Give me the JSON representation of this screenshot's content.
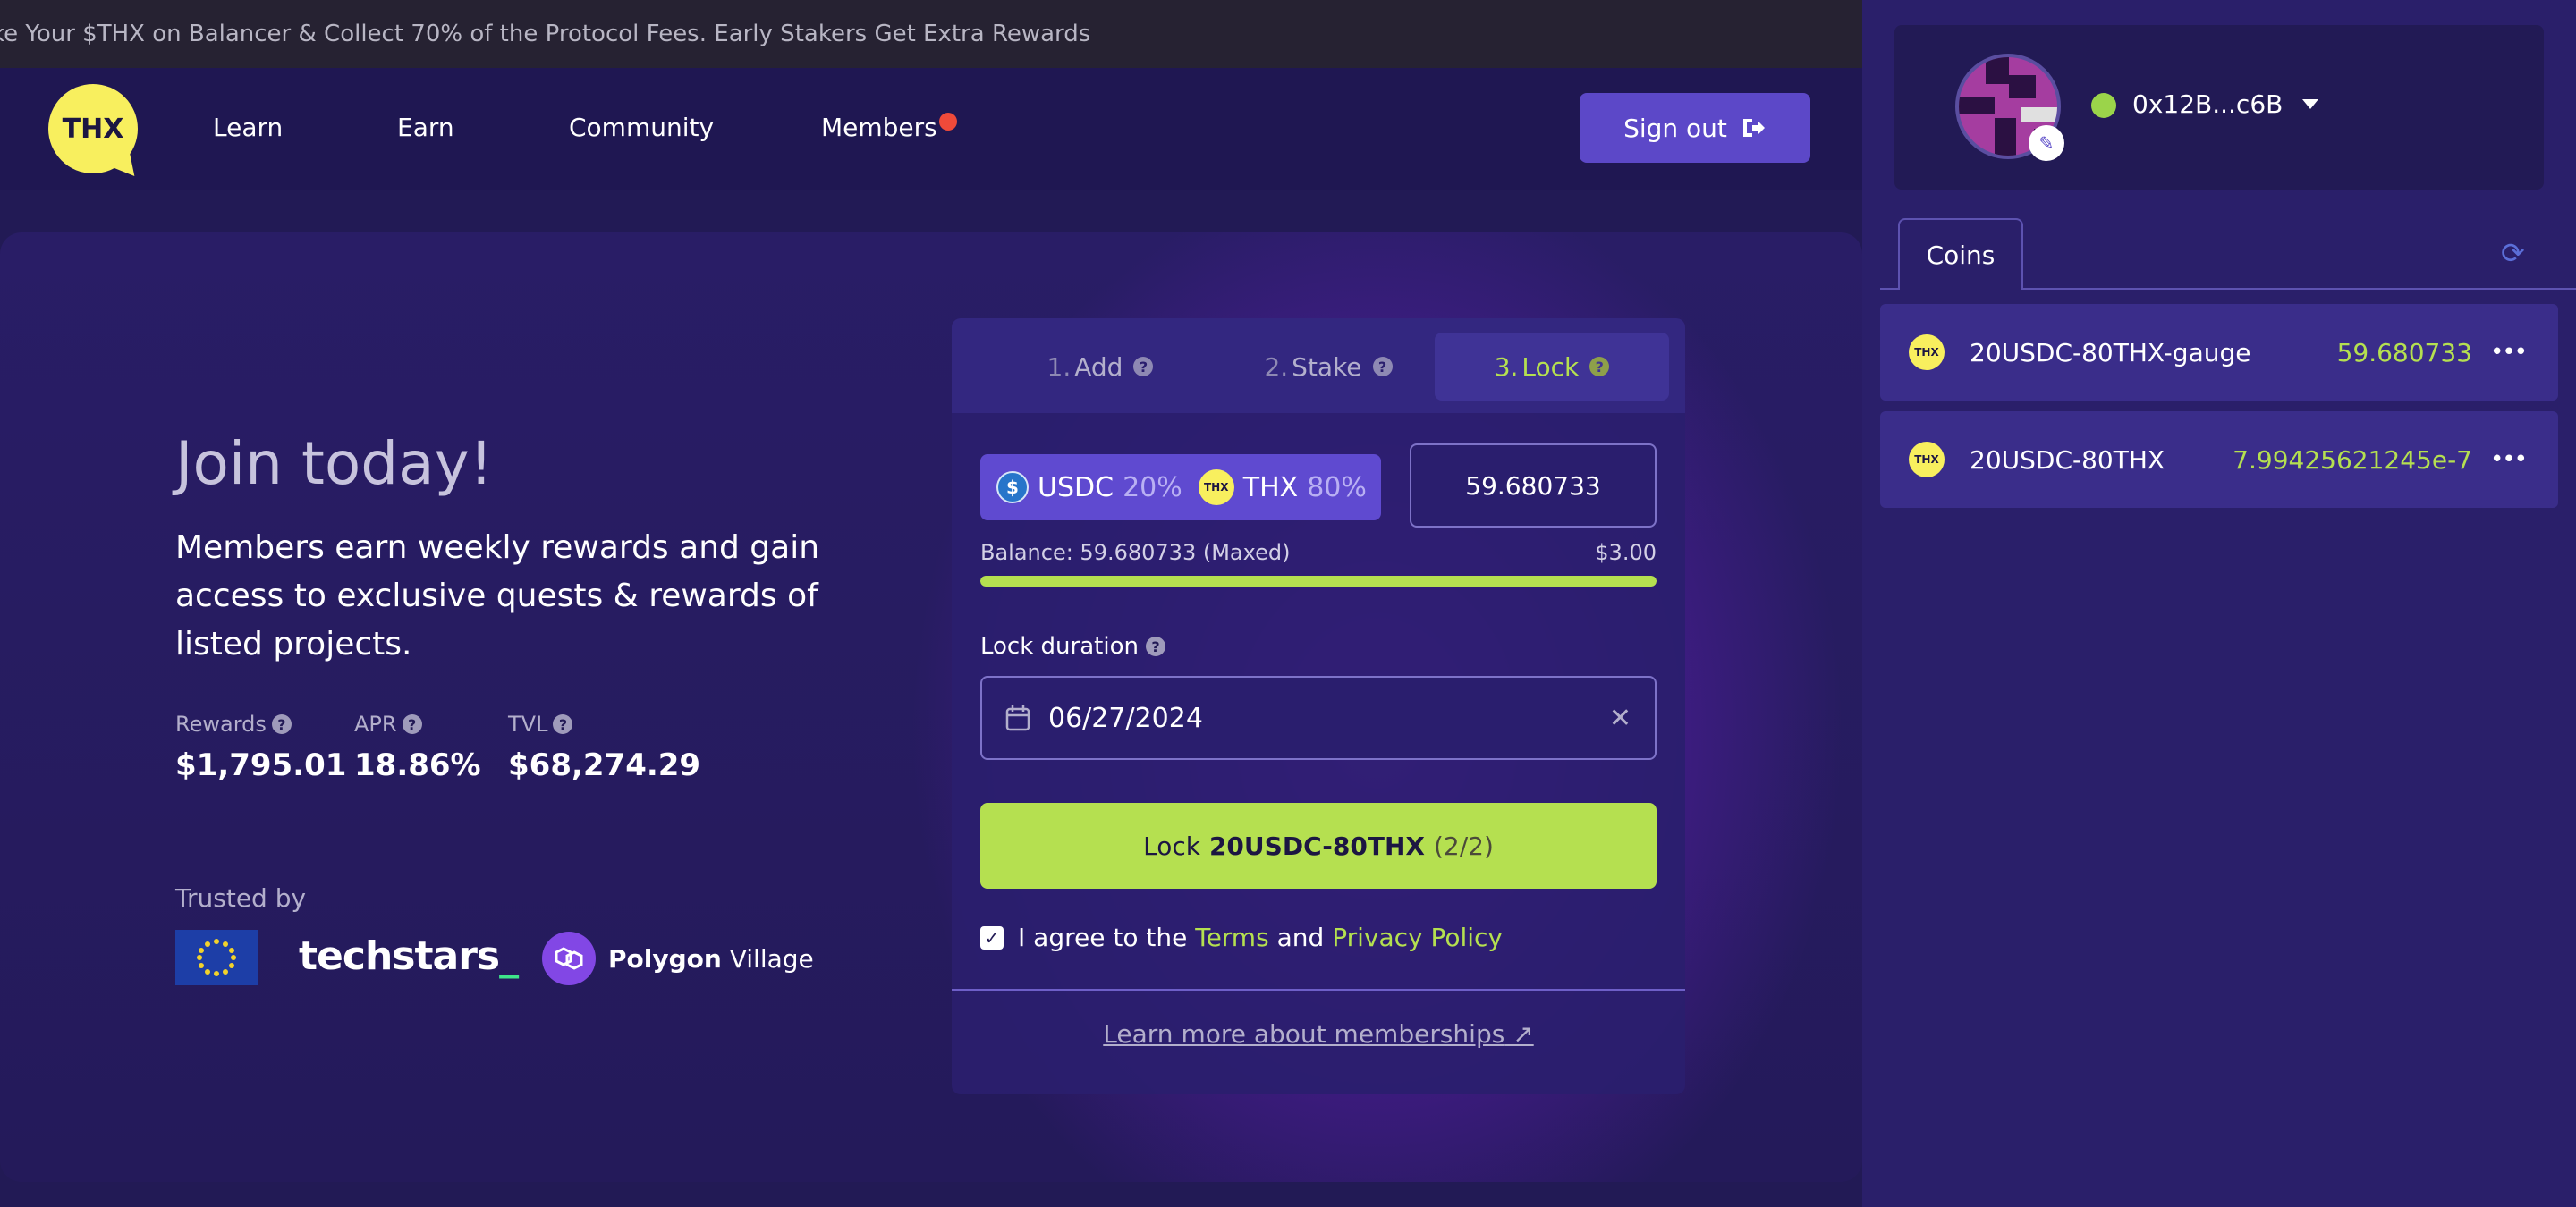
{
  "announcement": "ke Your $THX on Balancer & Collect 70% of the Protocol Fees. Early Stakers Get Extra Rewards",
  "brand": {
    "logo_text": "THX",
    "accent": "#b5e050",
    "logo_color": "#f8ef5e"
  },
  "nav": {
    "items": [
      {
        "label": "Learn"
      },
      {
        "label": "Earn"
      },
      {
        "label": "Community"
      },
      {
        "label": "Members"
      }
    ],
    "sign_out_label": "Sign out"
  },
  "hero": {
    "title": "Join today!",
    "description": "Members earn weekly rewards and gain access to exclusive quests & rewards of listed projects.",
    "stats": [
      {
        "label": "Rewards",
        "value": "$1,795.01"
      },
      {
        "label": "APR",
        "value": "18.86%"
      },
      {
        "label": "TVL",
        "value": "$68,274.29"
      }
    ],
    "trusted_by": "Trusted by",
    "partners": {
      "techstars": "techstars",
      "techstars_suffix": "_",
      "polygon_bold": "Polygon",
      "polygon_rest": "Village"
    }
  },
  "staking": {
    "tabs": [
      {
        "num": "1.",
        "label": "Add"
      },
      {
        "num": "2.",
        "label": "Stake"
      },
      {
        "num": "3.",
        "label": "Lock"
      }
    ],
    "active_tab": 2,
    "pool": {
      "token1": "USDC",
      "token1_pct": "20%",
      "token2": "THX",
      "token2_pct": "80%"
    },
    "amount": "59.680733",
    "balance_label": "Balance: 59.680733 (Maxed)",
    "balance_usd": "$3.00",
    "balance_fill": 1.0,
    "lock_duration_label": "Lock duration",
    "lock_date": "06/27/2024",
    "lock_button": {
      "prefix": "Lock",
      "token": "20USDC-80THX",
      "step": "(2/2)"
    },
    "agree": {
      "text1": "I agree to the",
      "terms": "Terms",
      "and": "and",
      "privacy": "Privacy Policy",
      "checked": true
    },
    "learn_more": "Learn more about memberships"
  },
  "account": {
    "address": "0x12B...c6B",
    "status": "online",
    "coins_tab": "Coins",
    "coins": [
      {
        "name": "20USDC-80THX-gauge",
        "balance": "59.680733"
      },
      {
        "name": "20USDC-80THX",
        "balance": "7.99425621245e-7"
      }
    ]
  }
}
